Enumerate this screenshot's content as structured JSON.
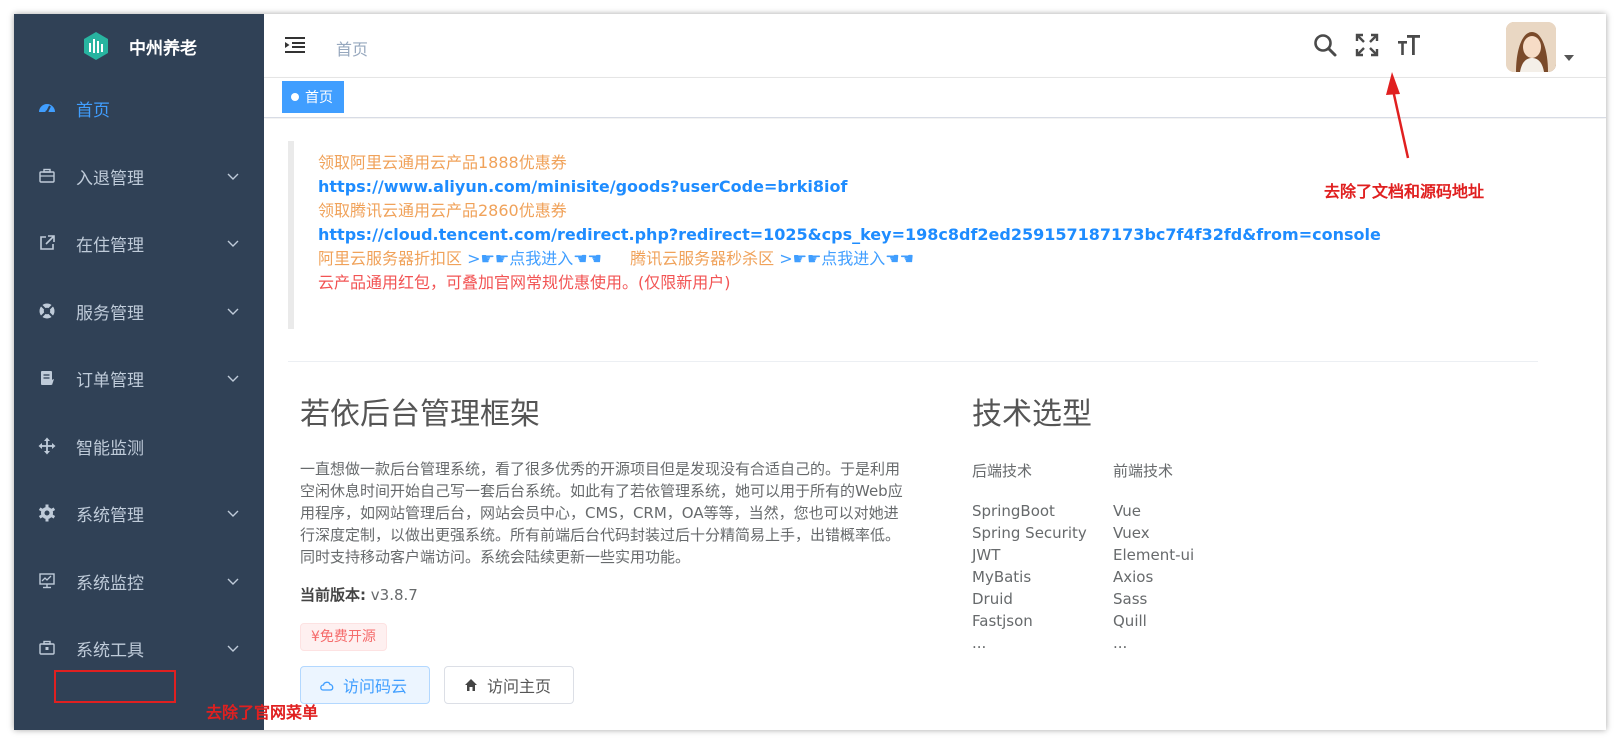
{
  "app": {
    "title": "中州养老"
  },
  "colors": {
    "sidebar_bg": "#304156",
    "accent": "#409eff",
    "annotation": "#e02020"
  },
  "sidebar": {
    "items": [
      {
        "label": "首页",
        "icon": "dashboard-icon",
        "active": true,
        "expandable": false
      },
      {
        "label": "入退管理",
        "icon": "briefcase-icon",
        "active": false,
        "expandable": true
      },
      {
        "label": "在住管理",
        "icon": "external-link-icon",
        "active": false,
        "expandable": true
      },
      {
        "label": "服务管理",
        "icon": "lifebuoy-icon",
        "active": false,
        "expandable": true
      },
      {
        "label": "订单管理",
        "icon": "document-icon",
        "active": false,
        "expandable": true
      },
      {
        "label": "智能监测",
        "icon": "move-icon",
        "active": false,
        "expandable": false
      },
      {
        "label": "系统管理",
        "icon": "gear-icon",
        "active": false,
        "expandable": true
      },
      {
        "label": "系统监控",
        "icon": "monitor-icon",
        "active": false,
        "expandable": true
      },
      {
        "label": "系统工具",
        "icon": "toolbox-icon",
        "active": false,
        "expandable": true
      }
    ]
  },
  "header": {
    "breadcrumb": "首页",
    "icons": [
      "search-icon",
      "fullscreen-icon",
      "font-size-icon"
    ]
  },
  "tags": {
    "active": "首页"
  },
  "notice": {
    "line1": "领取阿里云通用云产品1888优惠券",
    "line2": "https://www.aliyun.com/minisite/goods?userCode=brki8iof",
    "line3": "领取腾讯云通用云产品2860优惠券",
    "line4": "https://cloud.tencent.com/redirect.php?redirect=1025&cps_key=198c8df2ed259157187173bc7f4f32fd&from=console",
    "aliyun_zone": "阿里云服务器折扣区",
    "aliyun_link": ">☛☛点我进入☚☚",
    "tencent_zone": "腾讯云服务器秒杀区",
    "tencent_link": ">☛☛点我进入☚☚",
    "line6": "云产品通用红包，可叠加官网常规优惠使用。(仅限新用户)"
  },
  "intro": {
    "title": "若依后台管理框架",
    "description": "一直想做一款后台管理系统，看了很多优秀的开源项目但是发现没有合适自己的。于是利用空闲休息时间开始自己写一套后台系统。如此有了若依管理系统，她可以用于所有的Web应用程序，如网站管理后台，网站会员中心，CMS，CRM，OA等等，当然，您也可以对她进行深度定制，以做出更强系统。所有前端后台代码封装过后十分精简易上手，出错概率低。同时支持移动客户端访问。系统会陆续更新一些实用功能。",
    "version_label": "当前版本:",
    "version": "v3.8.7",
    "free_tag": "¥免费开源",
    "btn_gitee": "访问码云",
    "btn_home": "访问主页"
  },
  "tech": {
    "title": "技术选型",
    "backend_label": "后端技术",
    "frontend_label": "前端技术",
    "backend": [
      "SpringBoot",
      "Spring Security",
      "JWT",
      "MyBatis",
      "Druid",
      "Fastjson",
      "..."
    ],
    "frontend": [
      "Vue",
      "Vuex",
      "Element-ui",
      "Axios",
      "Sass",
      "Quill",
      "..."
    ]
  },
  "annotations": {
    "header_note": "去除了文档和源码地址",
    "menu_note": "去除了官网菜单"
  }
}
